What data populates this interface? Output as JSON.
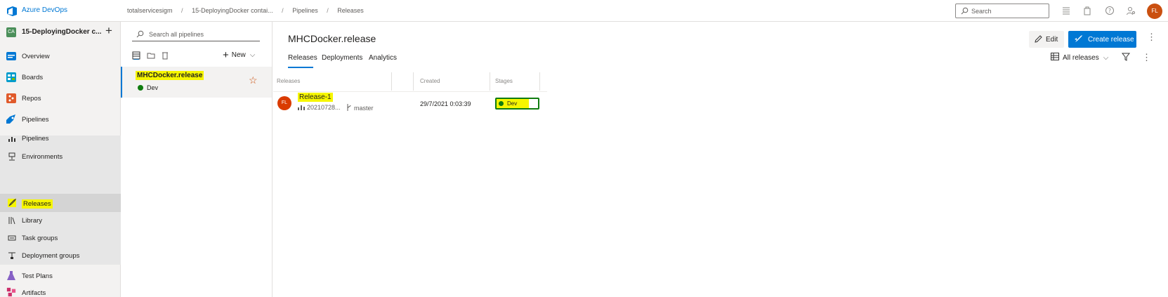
{
  "header": {
    "brand": "Azure DevOps",
    "breadcrumbs": [
      "totalservicesigm",
      "15-DeployingDocker contai...",
      "Pipelines",
      "Releases"
    ],
    "search_placeholder": "Search",
    "user_initials": "FL"
  },
  "sidebar": {
    "project_initials": "CA",
    "project_name": "15-DeployingDocker c...",
    "items": [
      {
        "label": "Overview",
        "icon": "overview-icon",
        "color": "#0078d4"
      },
      {
        "label": "Boards",
        "icon": "boards-icon",
        "color": "#009ccc"
      },
      {
        "label": "Repos",
        "icon": "repos-icon",
        "color": "#e05a2b"
      },
      {
        "label": "Pipelines",
        "icon": "pipelines-icon",
        "color": "#0078d4"
      },
      {
        "label": "Pipelines",
        "icon": "pipelines-sub-icon"
      },
      {
        "label": "Environments",
        "icon": "environments-icon"
      },
      {
        "label": "Releases",
        "icon": "releases-icon"
      },
      {
        "label": "Library",
        "icon": "library-icon"
      },
      {
        "label": "Task groups",
        "icon": "task-groups-icon"
      },
      {
        "label": "Deployment groups",
        "icon": "deployment-groups-icon"
      },
      {
        "label": "Test Plans",
        "icon": "test-plans-icon",
        "color": "#8661c5"
      },
      {
        "label": "Artifacts",
        "icon": "artifacts-icon",
        "color": "#cc2f6a"
      }
    ]
  },
  "pane": {
    "search_placeholder": "Search all pipelines",
    "new_label": "New",
    "pipeline": {
      "name": "MHCDocker.release",
      "environment": "Dev"
    }
  },
  "main": {
    "title": "MHCDocker.release",
    "edit_label": "Edit",
    "create_label": "Create release",
    "tabs": [
      "Releases",
      "Deployments",
      "Analytics"
    ],
    "filter_label": "All releases",
    "columns": [
      "Releases",
      "Created",
      "Stages"
    ],
    "release": {
      "avatar": "FL",
      "name": "Release-1",
      "build": "20210728...",
      "branch": "master",
      "created": "29/7/2021 0:03:39",
      "stage": "Dev"
    }
  },
  "colors": {
    "accent": "#0078d4",
    "highlight": "#f6f600",
    "success": "#107c10"
  }
}
